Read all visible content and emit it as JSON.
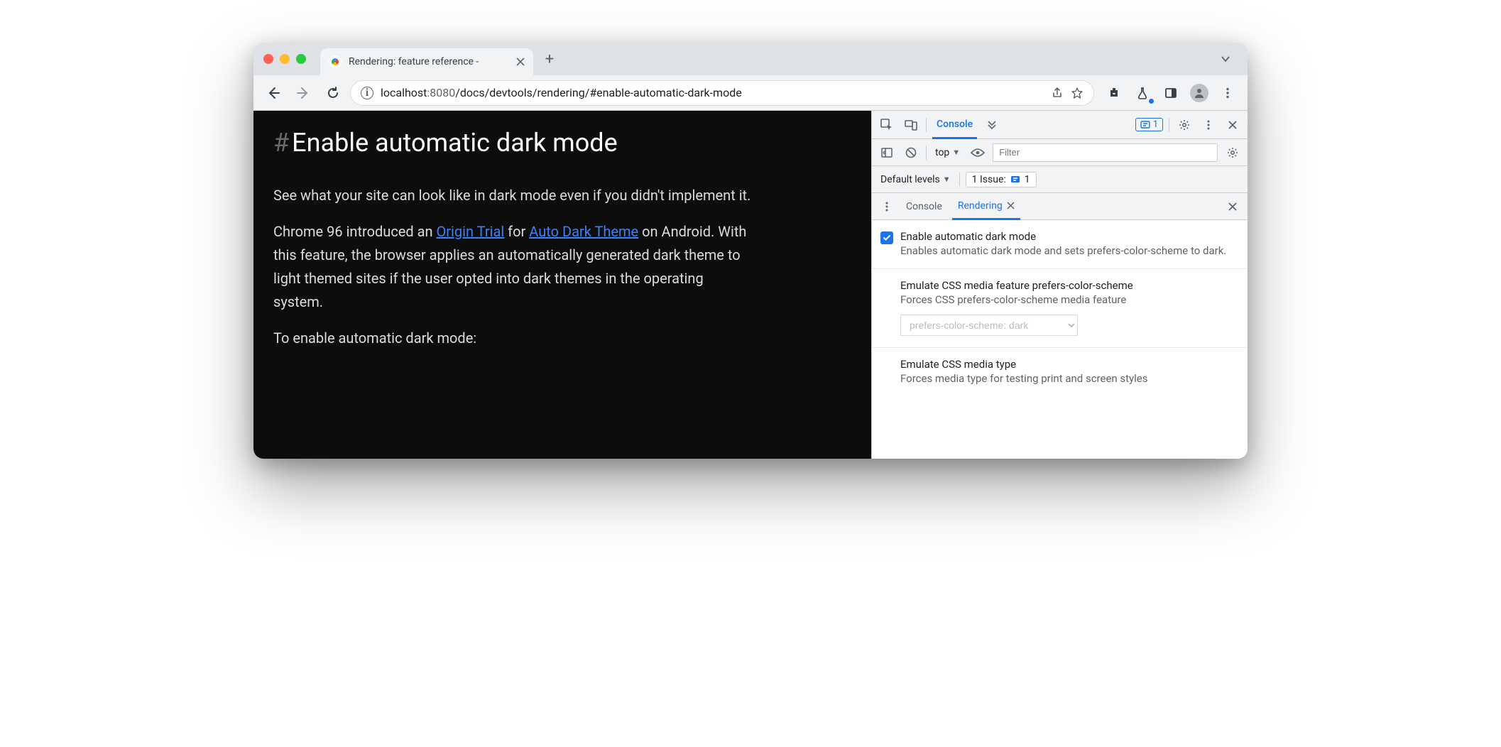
{
  "chrome": {
    "tab_title": "Rendering: feature reference - ",
    "url_host": "localhost",
    "url_port": ":8080",
    "url_path": "/docs/devtools/rendering/#enable-automatic-dark-mode"
  },
  "page": {
    "heading": "Enable automatic dark mode",
    "p1": "See what your site can look like in dark mode even if you didn't implement it.",
    "p2a": "Chrome 96 introduced an ",
    "link1": "Origin Trial",
    "p2b": " for ",
    "link2": "Auto Dark Theme",
    "p2c": " on Android. With this feature, the browser applies an automatically generated dark theme to light themed sites if the user opted into dark themes in the operating system.",
    "p3": "To enable automatic dark mode:"
  },
  "devtools": {
    "main_tab": "Console",
    "issues_badge": "1",
    "context": "top",
    "filter_placeholder": "Filter",
    "levels_label": "Default levels",
    "issues_label": "1 Issue:",
    "issues_count": "1",
    "drawer": {
      "tab_console": "Console",
      "tab_rendering": "Rendering"
    },
    "settings": {
      "dark_title": "Enable automatic dark mode",
      "dark_desc": "Enables automatic dark mode and sets prefers-color-scheme to dark.",
      "pcs_title": "Emulate CSS media feature prefers-color-scheme",
      "pcs_desc": "Forces CSS prefers-color-scheme media feature",
      "pcs_value": "prefers-color-scheme: dark",
      "media_title": "Emulate CSS media type",
      "media_desc": "Forces media type for testing print and screen styles"
    }
  }
}
